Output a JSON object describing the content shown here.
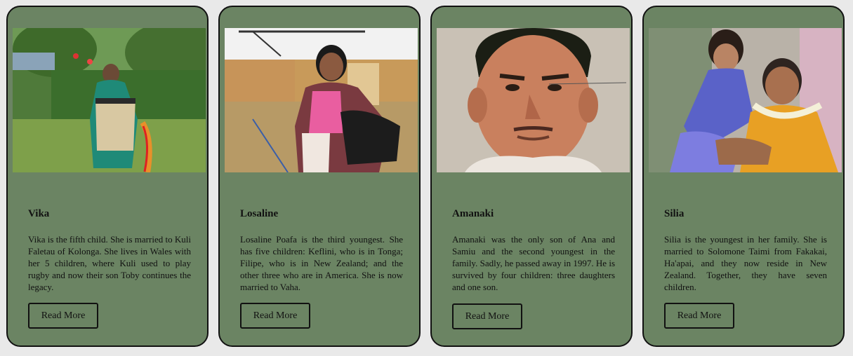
{
  "cards": [
    {
      "name": "Vika",
      "description": "Vika is the fifth child. She is married to Kuli Faletau of Kolonga. She lives in Wales with her 5 children, where Kuli used to play rugby and now their son Toby continues the legacy.",
      "button_label": "Read More"
    },
    {
      "name": "Losaline",
      "description": "Losaline Poafa is the third youngest. She has five children: Keflini, who is in Tonga; Filipe, who is in New Zealand; and the other three who are in America. She is now married to Vaha.",
      "button_label": "Read More"
    },
    {
      "name": "Amanaki",
      "description": "Amanaki was the only son of Ana and Samiu and the second youngest in the family. Sadly, he passed away in 1997. He is survived by four children: three daughters and one son.",
      "button_label": "Read More"
    },
    {
      "name": "Silia",
      "description": "Silia is the youngest in her family. She is married to Solomone Taimi from Fakakai, Ha'apai, and they now reside in New Zealand. Together, they have seven children.",
      "button_label": "Read More"
    }
  ],
  "colors": {
    "card_background": "#6b8463",
    "page_background": "#e9e9e9",
    "border": "#111111"
  }
}
